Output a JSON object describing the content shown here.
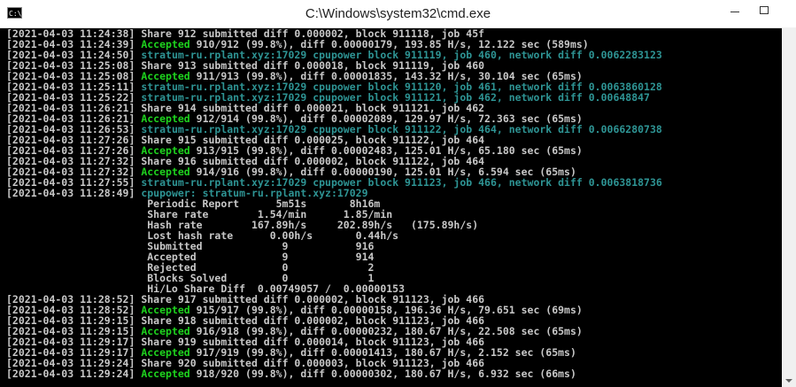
{
  "window": {
    "title": "C:\\Windows\\system32\\cmd.exe",
    "icon_text": "C:\\"
  },
  "console": {
    "lines": [
      [
        {
          "t": "[2021-04-03 11:24:38] ",
          "c": "white"
        },
        {
          "t": "Share 912 submitted diff 0.000002, block 911118, job 45f",
          "c": "white"
        }
      ],
      [
        {
          "t": "[2021-04-03 11:24:39] ",
          "c": "white"
        },
        {
          "t": "Accepted",
          "c": "green"
        },
        {
          "t": " 910/912 (99.8%), diff 0.00000179, 193.85 H/s, 12.122 sec (589ms)",
          "c": "white"
        }
      ],
      [
        {
          "t": "[2021-04-03 11:24:50] ",
          "c": "white"
        },
        {
          "t": "stratum-ru.rplant.xyz:17029 cpupower block 911119, job 460, network diff 0.0062283123",
          "c": "teal"
        }
      ],
      [
        {
          "t": "[2021-04-03 11:25:08] ",
          "c": "white"
        },
        {
          "t": "Share 913 submitted diff 0.000018, block 911119, job 460",
          "c": "white"
        }
      ],
      [
        {
          "t": "[2021-04-03 11:25:08] ",
          "c": "white"
        },
        {
          "t": "Accepted",
          "c": "green"
        },
        {
          "t": " 911/913 (99.8%), diff 0.00001835, 143.32 H/s, 30.104 sec (65ms)",
          "c": "white"
        }
      ],
      [
        {
          "t": "[2021-04-03 11:25:11] ",
          "c": "white"
        },
        {
          "t": "stratum-ru.rplant.xyz:17029 cpupower block 911120, job 461, network diff 0.0063860128",
          "c": "teal"
        }
      ],
      [
        {
          "t": "[2021-04-03 11:25:22] ",
          "c": "white"
        },
        {
          "t": "stratum-ru.rplant.xyz:17029 cpupower block 911121, job 462, network diff 0.00648847",
          "c": "teal"
        }
      ],
      [
        {
          "t": "[2021-04-03 11:26:21] ",
          "c": "white"
        },
        {
          "t": "Share 914 submitted diff 0.000021, block 911121, job 462",
          "c": "white"
        }
      ],
      [
        {
          "t": "[2021-04-03 11:26:21] ",
          "c": "white"
        },
        {
          "t": "Accepted",
          "c": "green"
        },
        {
          "t": " 912/914 (99.8%), diff 0.00002089, 129.97 H/s, 72.363 sec (65ms)",
          "c": "white"
        }
      ],
      [
        {
          "t": "[2021-04-03 11:26:53] ",
          "c": "white"
        },
        {
          "t": "stratum-ru.rplant.xyz:17029 cpupower block 911122, job 464, network diff 0.0066280738",
          "c": "teal"
        }
      ],
      [
        {
          "t": "[2021-04-03 11:27:26] ",
          "c": "white"
        },
        {
          "t": "Share 915 submitted diff 0.000025, block 911122, job 464",
          "c": "white"
        }
      ],
      [
        {
          "t": "[2021-04-03 11:27:26] ",
          "c": "white"
        },
        {
          "t": "Accepted",
          "c": "green"
        },
        {
          "t": " 913/915 (99.8%), diff 0.00002483, 125.01 H/s, 65.180 sec (65ms)",
          "c": "white"
        }
      ],
      [
        {
          "t": "[2021-04-03 11:27:32] ",
          "c": "white"
        },
        {
          "t": "Share 916 submitted diff 0.000002, block 911122, job 464",
          "c": "white"
        }
      ],
      [
        {
          "t": "[2021-04-03 11:27:32] ",
          "c": "white"
        },
        {
          "t": "Accepted",
          "c": "green"
        },
        {
          "t": " 914/916 (99.8%), diff 0.00000190, 125.01 H/s, 6.594 sec (65ms)",
          "c": "white"
        }
      ],
      [
        {
          "t": "[2021-04-03 11:27:55] ",
          "c": "white"
        },
        {
          "t": "stratum-ru.rplant.xyz:17029 cpupower block 911123, job 466, network diff 0.0063818736",
          "c": "teal"
        }
      ],
      [
        {
          "t": "[2021-04-03 11:28:49] ",
          "c": "white"
        },
        {
          "t": "cpupower: stratum-ru.rplant.xyz:17029",
          "c": "teal"
        }
      ],
      [
        {
          "t": "                       Periodic Report      5m51s       8h16m",
          "c": "white"
        }
      ],
      [
        {
          "t": "                       Share rate        1.54/min      1.85/min",
          "c": "white"
        }
      ],
      [
        {
          "t": "                       Hash rate        167.89h/s     202.89h/s   (175.89h/s)",
          "c": "white"
        }
      ],
      [
        {
          "t": "                       Lost hash rate      0.00h/s       0.44h/s",
          "c": "white"
        }
      ],
      [
        {
          "t": "                       Submitted             9           916",
          "c": "white"
        }
      ],
      [
        {
          "t": "                       Accepted              9           914",
          "c": "white"
        }
      ],
      [
        {
          "t": "                       Rejected              0             2",
          "c": "white"
        }
      ],
      [
        {
          "t": "                       Blocks Solved         0             1",
          "c": "white"
        }
      ],
      [
        {
          "t": "                       Hi/Lo Share Diff  0.00749057 /  0.00000153",
          "c": "white"
        }
      ],
      [
        {
          "t": "[2021-04-03 11:28:52] ",
          "c": "white"
        },
        {
          "t": "Share 917 submitted diff 0.000002, block 911123, job 466",
          "c": "white"
        }
      ],
      [
        {
          "t": "[2021-04-03 11:28:52] ",
          "c": "white"
        },
        {
          "t": "Accepted",
          "c": "green"
        },
        {
          "t": " 915/917 (99.8%), diff 0.00000158, 196.36 H/s, 79.651 sec (69ms)",
          "c": "white"
        }
      ],
      [
        {
          "t": "[2021-04-03 11:29:15] ",
          "c": "white"
        },
        {
          "t": "Share 918 submitted diff 0.000002, block 911123, job 466",
          "c": "white"
        }
      ],
      [
        {
          "t": "[2021-04-03 11:29:15] ",
          "c": "white"
        },
        {
          "t": "Accepted",
          "c": "green"
        },
        {
          "t": " 916/918 (99.8%), diff 0.00000232, 180.67 H/s, 22.508 sec (65ms)",
          "c": "white"
        }
      ],
      [
        {
          "t": "[2021-04-03 11:29:17] ",
          "c": "white"
        },
        {
          "t": "Share 919 submitted diff 0.000014, block 911123, job 466",
          "c": "white"
        }
      ],
      [
        {
          "t": "[2021-04-03 11:29:17] ",
          "c": "white"
        },
        {
          "t": "Accepted",
          "c": "green"
        },
        {
          "t": " 917/919 (99.8%), diff 0.00001413, 180.67 H/s, 2.152 sec (65ms)",
          "c": "white"
        }
      ],
      [
        {
          "t": "[2021-04-03 11:29:24] ",
          "c": "white"
        },
        {
          "t": "Share 920 submitted diff 0.000003, block 911123, job 466",
          "c": "white"
        }
      ],
      [
        {
          "t": "[2021-04-03 11:29:24] ",
          "c": "white"
        },
        {
          "t": "Accepted",
          "c": "green"
        },
        {
          "t": " 918/920 (99.8%), diff 0.00000302, 180.67 H/s, 6.932 sec (66ms)",
          "c": "white"
        }
      ]
    ]
  },
  "colors": {
    "background": "#000000",
    "text": "#c8c8c8",
    "accepted": "#1ed31e",
    "stratum": "#2e9494"
  }
}
